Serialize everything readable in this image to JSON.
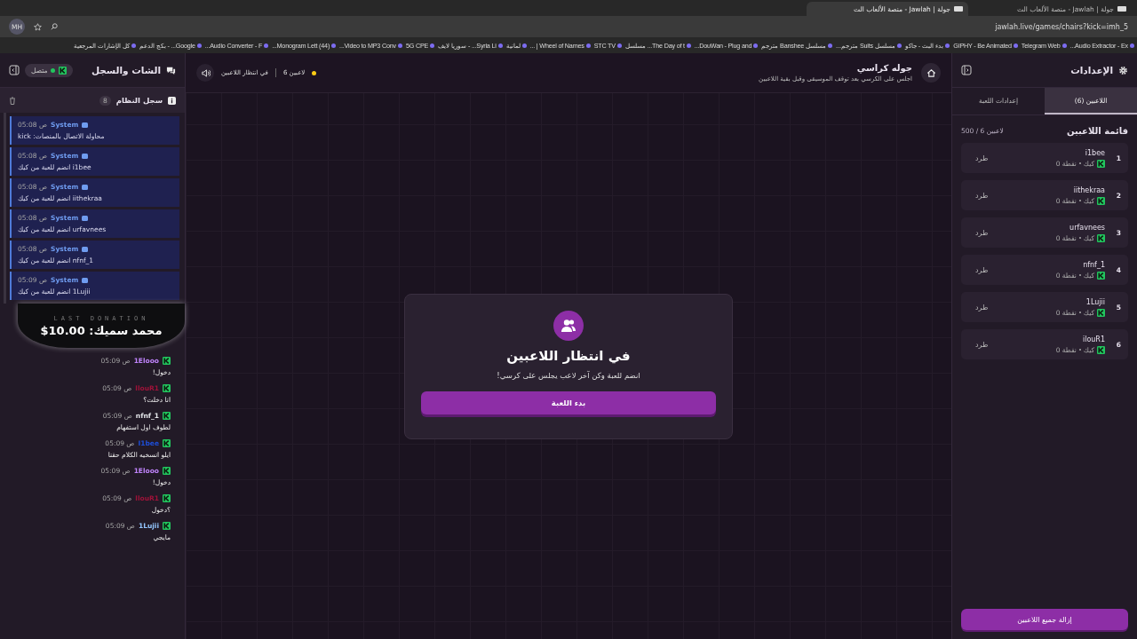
{
  "browser": {
    "tabs": [
      {
        "title": "جولة | Jawlah - منصة الألعاب الت",
        "selected": false
      },
      {
        "title": "جولة | Jawlah - منصة الألعاب الت",
        "selected": true
      }
    ],
    "address": "jawlah.live/games/chairs?kick=imh_5",
    "profile": "MH",
    "bookmarks": [
      "Audio Extractor - Ex...",
      "Telegram Web",
      "GIPHY - Be Animated",
      "بدء البث - جاكو",
      "مسلسل Suits مترجم...",
      "مسلسل Banshee مترجم",
      "DouWan - Plug and...",
      "The Day of t... مسلسل",
      "STC TV",
      "Wheel of Names | ...",
      "لمانية",
      "Syria Li... - سوريا لايف",
      "5G CPE",
      "Video to MP3 Conv...",
      "(44) Monogram Lett...",
      "Audio Converter - F...",
      "Google... - بكج الدعم",
      "كل الإشارات المرجعية"
    ]
  },
  "chat_panel": {
    "title": "الشات والسجل",
    "status": "متصل",
    "log_title": "سجل النظام",
    "log_count": "8",
    "log": [
      {
        "sender": "System",
        "time": "05:08 ص",
        "text": "محاولة الاتصال بالمنصات: kick"
      },
      {
        "sender": "System",
        "time": "05:08 ص",
        "text": "i1bee انضم للعبة من كيك"
      },
      {
        "sender": "System",
        "time": "05:08 ص",
        "text": "iithekraa انضم للعبة من كيك"
      },
      {
        "sender": "System",
        "time": "05:08 ص",
        "text": "urfavnees انضم للعبة من كيك"
      },
      {
        "sender": "System",
        "time": "05:08 ص",
        "text": "nfnf_1 انضم للعبة من كيك"
      },
      {
        "sender": "System",
        "time": "05:09 ص",
        "text": "1Lujii انضم للعبة من كيك"
      }
    ],
    "messages": [
      {
        "user": "1Elooo",
        "color": "#c084fc",
        "time": "05:09 ص",
        "text": "دخول!"
      },
      {
        "user": "llouR1",
        "color": "#9f1239",
        "time": "05:09 ص",
        "text": "انا دخلت؟"
      },
      {
        "user": "nfnf_1",
        "color": "#e5e7eb",
        "time": "05:09 ص",
        "text": "لطوف اول استفهام"
      },
      {
        "user": "I1bee",
        "color": "#1d4ed8",
        "time": "05:09 ص",
        "text": "ايلو انسخيه الكلام حقنا"
      },
      {
        "user": "1Elooo",
        "color": "#c084fc",
        "time": "05:09 ص",
        "text": "دخول!"
      },
      {
        "user": "llouR1",
        "color": "#9f1239",
        "time": "05:09 ص",
        "text": "؟دخول"
      },
      {
        "user": "1Lujii",
        "color": "#93c5fd",
        "time": "05:09 ص",
        "text": "مايجي"
      }
    ]
  },
  "donation": {
    "caption": "LAST DONATION",
    "text": "محمد سميك: 10.00$"
  },
  "game": {
    "title": "جوله كراسي",
    "subtitle": "اجلس على الكرسي بعد توقف الموسيقى وقبل بقية اللاعبين",
    "players": "6 لاعبين",
    "status": "في انتظار اللاعبين"
  },
  "waiting_card": {
    "title": "في انتظار اللاعبين",
    "text": "انضم للعبة وكن آخر لاعب يجلس على كرسي!",
    "button": "بدء اللعبة"
  },
  "settings_panel": {
    "title": "الإعدادات",
    "tabs": [
      {
        "label": "اللاعبين (6)",
        "selected": true
      },
      {
        "label": "إعدادات اللعبة",
        "selected": false
      }
    ],
    "list_title": "قائمة اللاعبين",
    "count": "500 / 6 لاعبين",
    "players": [
      {
        "rank": "1",
        "name": "i1bee",
        "platform": "كيك",
        "points": "0 نقطة",
        "action": "طرد"
      },
      {
        "rank": "2",
        "name": "iithekraa",
        "platform": "كيك",
        "points": "0 نقطة",
        "action": "طرد"
      },
      {
        "rank": "3",
        "name": "urfavnees",
        "platform": "كيك",
        "points": "0 نقطة",
        "action": "طرد"
      },
      {
        "rank": "4",
        "name": "nfnf_1",
        "platform": "كيك",
        "points": "0 نقطة",
        "action": "طرد"
      },
      {
        "rank": "5",
        "name": "1Lujii",
        "platform": "كيك",
        "points": "0 نقطة",
        "action": "طرد"
      },
      {
        "rank": "6",
        "name": "ilouR1",
        "platform": "كيك",
        "points": "0 نقطة",
        "action": "طرد"
      }
    ],
    "clear_button": "إزالة جميع اللاعبين"
  }
}
